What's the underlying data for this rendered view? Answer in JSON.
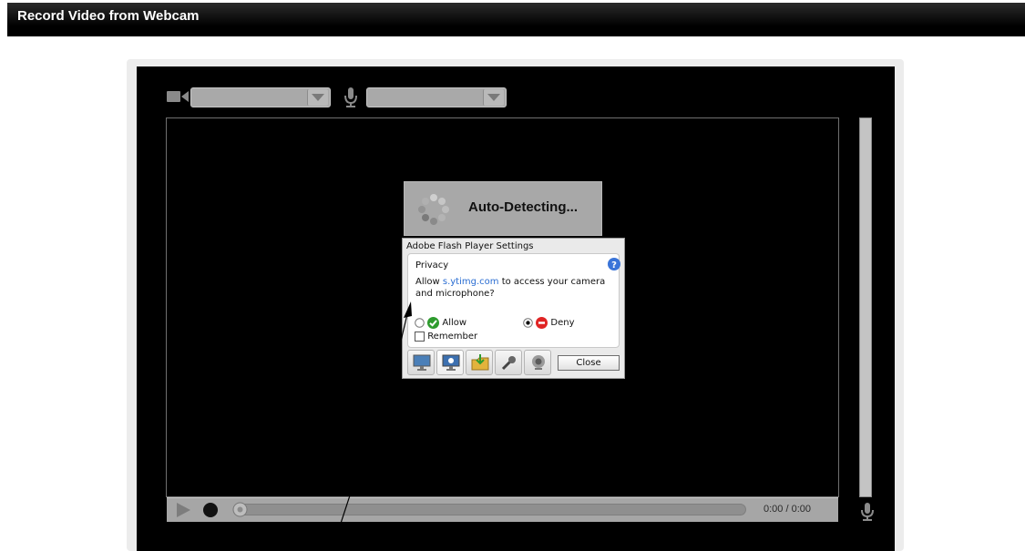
{
  "page": {
    "title": "Record Video from Webcam"
  },
  "recorder": {
    "camera_select": {
      "value": ""
    },
    "mic_select": {
      "value": ""
    },
    "status": {
      "text": "Auto-Detecting..."
    },
    "controls": {
      "time": "0:00 / 0:00"
    }
  },
  "flash_dialog": {
    "title": "Adobe Flash Player Settings",
    "section": "Privacy",
    "message_prefix": "Allow ",
    "domain": "s.ytimg.com",
    "message_suffix": " to access your camera and microphone?",
    "allow_label": "Allow",
    "deny_label": "Deny",
    "remember_label": "Remember",
    "selected": "Deny",
    "remember_checked": false,
    "close_label": "Close"
  },
  "colors": {
    "allow_icon": "#2e9b2e",
    "deny_icon": "#e02424",
    "help_icon": "#3a74d8",
    "link": "#2a6dd2"
  },
  "icons": [
    "video-camera-icon",
    "microphone-icon",
    "dropdown-arrow-icon",
    "loading-spinner-icon",
    "help-icon",
    "check-icon",
    "deny-icon",
    "display-icon",
    "privacy-icon",
    "local-storage-icon",
    "microphone-settings-icon",
    "webcam-settings-icon",
    "play-icon",
    "record-icon"
  ]
}
